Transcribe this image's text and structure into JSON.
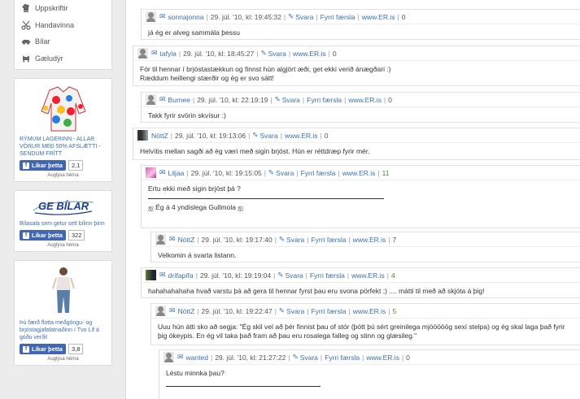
{
  "sidebar": {
    "menu": [
      {
        "label": "Uppskriftir",
        "icon": "chef-hat-icon"
      },
      {
        "label": "Handavinna",
        "icon": "scissors-icon"
      },
      {
        "label": "Bílar",
        "icon": "car-icon"
      },
      {
        "label": "Gæludýr",
        "icon": "pet-icon"
      }
    ],
    "ads": [
      {
        "caption": "RÝMUM LAGERINN - ALLAR VÖRUR MEÐ 50% AFSLÆTTI - SENDUM FRÍTT",
        "like": "Líkar þetta",
        "count": "2,1",
        "small": "Auglýsa hérna"
      },
      {
        "brand": "GE BÍLAR",
        "caption": "Bílasala sem getur selt bílinn þinn",
        "like": "Líkar þetta",
        "count": "322",
        "small": "Auglýsa hérna"
      },
      {
        "caption": "Þú færð flotta meðgöngu- og brjóstagjafafatnaðinn í Tvo Líf á góðu verði!",
        "like": "Líkar þetta",
        "count": "3,8",
        "small": "Auglýsa hérna"
      }
    ]
  },
  "comments": [
    {
      "user": "sonnajonna",
      "date": "29. júl. '10, kl: 19:45:32",
      "actions": [
        "Svara",
        "Fyrri færsla",
        "www.ER.is"
      ],
      "count": "0",
      "lines": [
        "já ég er alveg sammála þessu"
      ]
    },
    {
      "user": "tafyla",
      "date": "29. júl. '10, kl: 18:45:27",
      "actions": [
        "Svara",
        "www.ER.is"
      ],
      "count": "0",
      "lines": [
        "Fór til hennar í brjóstastækkun og finnst hún algjört æði, get ekki verið ánægðari :)",
        "Ræddum heillengi stærðir og ég er svo sátt!"
      ]
    },
    {
      "user": "Burnee",
      "date": "29. júl. '10, kl: 22:19:19",
      "actions": [
        "Svara",
        "Fyrri færsla",
        "www.ER.is"
      ],
      "count": "0",
      "lines": [
        "Takk fyrir svörin skvísur :)"
      ]
    },
    {
      "user": "NöttZ",
      "date": "29. júl. '10, kl: 19:13:06",
      "actions": [
        "Svara",
        "www.ER.is"
      ],
      "count": "0",
      "lines": [
        "Helvítis mellan sagði að ég væri með sigin brjóst. Hún er réttdræp fyrir mér."
      ]
    },
    {
      "user": "Liljaa",
      "date": "29. júl. '10, kl: 19:15:05",
      "actions": [
        "Svara",
        "Fyrri færsla",
        "www.ER.is"
      ],
      "count": "11",
      "lines": [
        "Ertu ekki með sigin brjóst þá ?",
        "ஐ Ég á 4 yndislega Gullmola ஐ"
      ]
    },
    {
      "user": "NöttZ",
      "date": "29. júl. '10, kl: 19:17:40",
      "actions": [
        "Svara",
        "Fyrri færsla",
        "www.ER.is"
      ],
      "count": "7",
      "lines": [
        "Velkomin á svarta listann."
      ]
    },
    {
      "user": "drífapífa",
      "date": "29. júl. '10, kl: 19:19:04",
      "actions": [
        "Svara",
        "Fyrri færsla",
        "www.ER.is"
      ],
      "count": "4",
      "lines": [
        "hahahahahaha hvað varstu þá að gera til hennar fyrst þau eru svona pörfekt ;) .... mátti til með að skjóta á þig!"
      ]
    },
    {
      "user": "NöttZ",
      "date": "29. júl. '10, kl: 19:22:47",
      "actions": [
        "Svara",
        "Fyrri færsla",
        "www.ER.is"
      ],
      "count": "5",
      "lines": [
        "Uuu hún átti sko að segja: \"Ég skil vel að þér finnist þau of stór (þótt þú sért greinilega mjööööög sexí stelpa) og ég skal laga það fyrir þig ókeypis. En ég vil taka það fram að þau eru rosalega falleg og stinn og glæsileg.\""
      ]
    },
    {
      "user": "wanted",
      "date": "29. júl. '10, kl: 21:27:22",
      "actions": [
        "Svara",
        "Fyrri færsla",
        "www.ER.is"
      ],
      "count": "0",
      "lines": [
        "Léstu minnka þau?"
      ]
    }
  ]
}
